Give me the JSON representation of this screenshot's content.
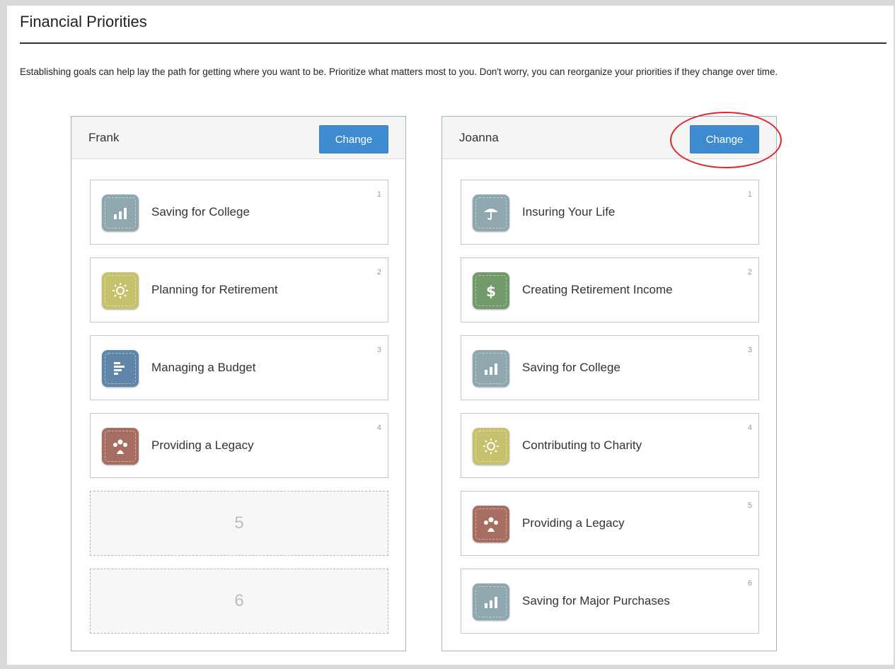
{
  "page": {
    "title": "Financial Priorities",
    "intro": "Establishing goals can help lay the path for getting where you want to be. Prioritize what matters most to you. Don't worry, you can reorganize your priorities if they change over time."
  },
  "colors": {
    "button": "#3e8ccf",
    "highlight_ring": "#e0262a",
    "icon_gray": "#8fa7ae",
    "icon_yellow": "#c6c16c",
    "icon_blue": "#5f86a8",
    "icon_brown": "#a66e62",
    "icon_green": "#739a6b"
  },
  "frank": {
    "name": "Frank",
    "change_label": "Change",
    "priorities": [
      {
        "rank": "1",
        "label": "Saving for College",
        "icon": "bar-chart-icon"
      },
      {
        "rank": "2",
        "label": "Planning for Retirement",
        "icon": "sun-icon"
      },
      {
        "rank": "3",
        "label": "Managing a Budget",
        "icon": "list-icon"
      },
      {
        "rank": "4",
        "label": "Providing a Legacy",
        "icon": "family-icon"
      }
    ],
    "empty_slots": [
      "5",
      "6"
    ]
  },
  "joanna": {
    "name": "Joanna",
    "change_label": "Change",
    "priorities": [
      {
        "rank": "1",
        "label": "Insuring Your Life",
        "icon": "umbrella-icon"
      },
      {
        "rank": "2",
        "label": "Creating Retirement Income",
        "icon": "dollar-icon"
      },
      {
        "rank": "3",
        "label": "Saving for College",
        "icon": "bar-chart-icon"
      },
      {
        "rank": "4",
        "label": "Contributing to Charity",
        "icon": "sun-icon"
      },
      {
        "rank": "5",
        "label": "Providing a Legacy",
        "icon": "family-icon"
      },
      {
        "rank": "6",
        "label": "Saving for Major Purchases",
        "icon": "bar-chart-icon"
      }
    ]
  }
}
